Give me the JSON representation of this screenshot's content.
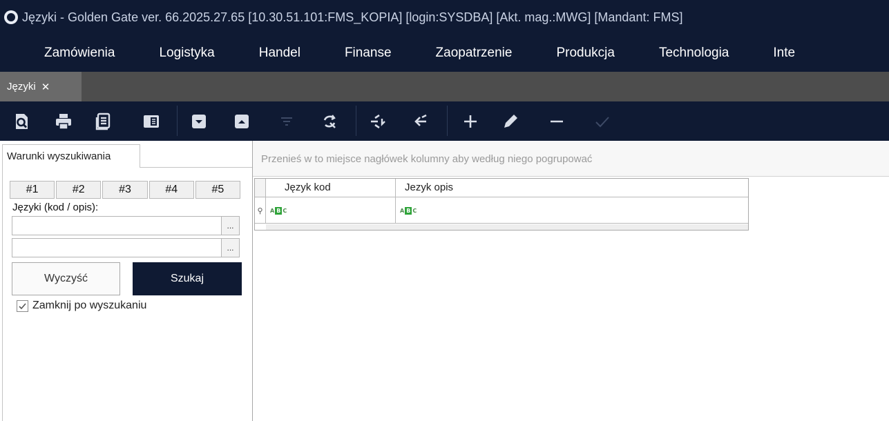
{
  "window": {
    "title": "Języki - Golden Gate ver. 66.2025.27.65 [10.30.51.101:FMS_KOPIA] [login:SYSDBA] [Akt. mag.:MWG] [Mandant: FMS]"
  },
  "menu": {
    "items": [
      {
        "label": "Zamówienia"
      },
      {
        "label": "Logistyka"
      },
      {
        "label": "Handel"
      },
      {
        "label": "Finanse"
      },
      {
        "label": "Zaopatrzenie"
      },
      {
        "label": "Produkcja"
      },
      {
        "label": "Technologia"
      },
      {
        "label": "Inte"
      }
    ]
  },
  "tabs": {
    "active": {
      "label": "Języki",
      "close": "✕"
    }
  },
  "toolbar": {
    "icons": [
      "preview-icon",
      "print-icon",
      "report-icon",
      "panel-icon",
      "import-icon",
      "export-icon",
      "filter-icon",
      "refresh-icon",
      "switch-icon",
      "back-icon",
      "add-icon",
      "edit-icon",
      "remove-icon",
      "confirm-icon"
    ]
  },
  "search_panel": {
    "tab_label": "Warunki wyszukiwania",
    "num_tabs": [
      "#1",
      "#2",
      "#3",
      "#4",
      "#5"
    ],
    "field_label": "Języki (kod / opis):",
    "field1_value": "",
    "field2_value": "",
    "dots": "...",
    "clear_label": "Wyczyść",
    "search_label": "Szukaj",
    "close_after_search_label": "Zamknij po wyszukaniu",
    "close_after_search_checked": true
  },
  "grid": {
    "group_hint": "Przenieś w to miejsce nagłówek kolumny aby według niego pogrupować",
    "columns": [
      "Język kod",
      "Jezyk opis"
    ],
    "filter_row_indicator": "⚲"
  },
  "colors": {
    "navy": "#0f1a33",
    "tab_strip": "#4d4d4d",
    "active_tab": "#6a6a6a"
  }
}
